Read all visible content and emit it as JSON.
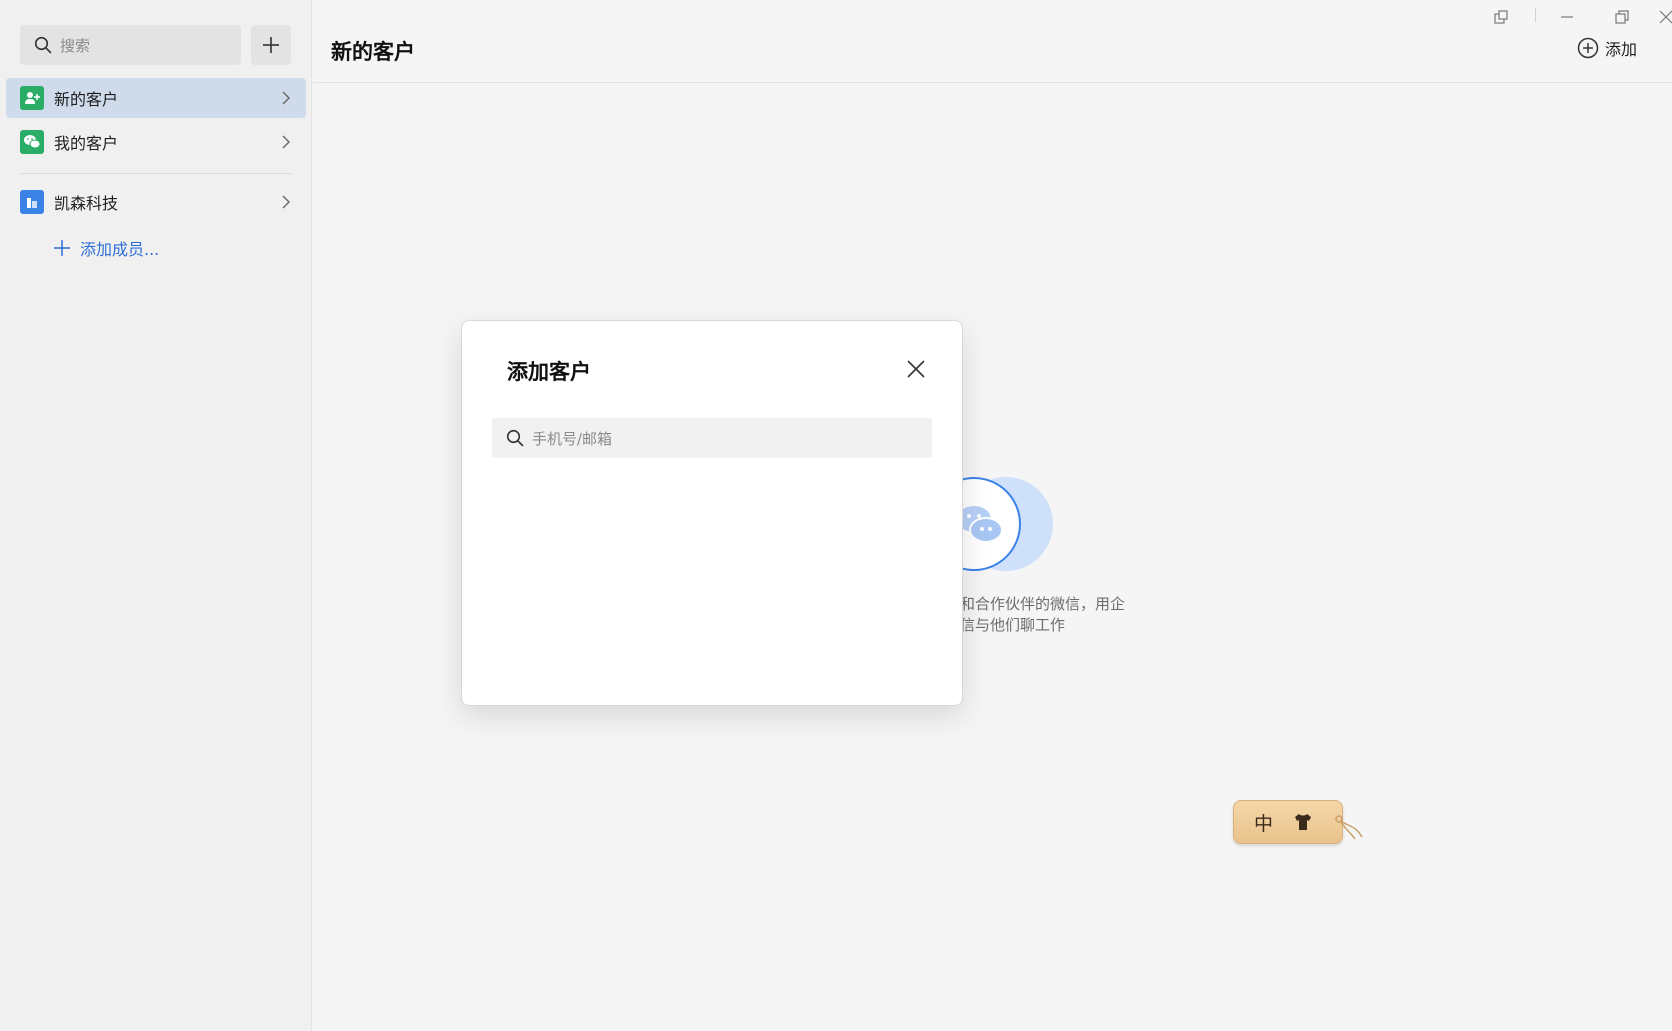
{
  "sidebar": {
    "search_placeholder": "搜索",
    "items": [
      {
        "label": "新的客户",
        "icon": "add-user-icon",
        "color": "#2aae67",
        "active": true
      },
      {
        "label": "我的客户",
        "icon": "wechat-icon",
        "color": "#2aae67",
        "active": false
      },
      {
        "label": "凯森科技",
        "icon": "company-icon",
        "color": "#3b82e6",
        "active": false
      }
    ],
    "add_member_label": "添加成员..."
  },
  "header": {
    "title": "新的客户",
    "add_label": "添加"
  },
  "empty_state": {
    "line1": "和合作伙伴的微信，用企",
    "line2": "信与他们聊工作"
  },
  "dialog": {
    "title": "添加客户",
    "search_placeholder": "手机号/邮箱"
  },
  "ime": {
    "mode": "中"
  },
  "colors": {
    "accent": "#2f6fd6",
    "active_bg": "#cfdaeb",
    "green": "#2aae67"
  }
}
